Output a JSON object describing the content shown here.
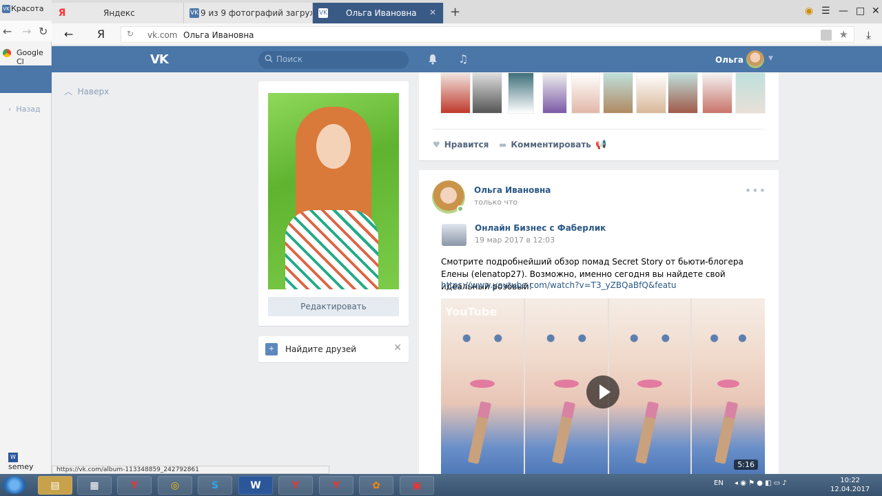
{
  "background_window": {
    "tab_title": "Красота",
    "bookmark": "Google Cl",
    "back_label": "Назад",
    "file_label": "semey"
  },
  "tabs": [
    {
      "title": "Яндекс",
      "icon": "yandex-icon"
    },
    {
      "title": "9 из 9 фотографий загруже",
      "icon": "vk-icon"
    },
    {
      "title": "Ольга Ивановна",
      "icon": "vk-icon",
      "active": true
    }
  ],
  "address": {
    "domain": "vk.com",
    "page_title": "Ольга Ивановна"
  },
  "vk": {
    "logo": "VK",
    "search_placeholder": "Поиск",
    "user_name": "Ольга",
    "nav_up": "Наверх"
  },
  "profile": {
    "edit_button": "Редактировать",
    "find_friends": "Найдите друзей"
  },
  "post_prev": {
    "like_label": "Нравится",
    "comment_label": "Комментировать"
  },
  "post": {
    "author": "Ольга Ивановна",
    "time": "только что",
    "repost_author": "Онлайн Бизнес с Фаберлик",
    "repost_time": "19 мар 2017 в 12:03",
    "text": "Смотрите подробнейший обзор помад Secret Story от бьюти-блогера Елены (elenatop27). Возможно, именно сегодня вы найдете свой идеальный розовый!",
    "link": "https://www.youtube.com/watch?v=T3_yZBQaBfQ&featu",
    "video_logo": "YouTube",
    "video_duration": "5:16"
  },
  "status_url": "https://vk.com/album-113348859_242792861",
  "taskbar": {
    "lang": "EN",
    "time": "10:22",
    "date": "12.04.2017"
  },
  "colors": {
    "vk_blue": "#4a76a8",
    "link": "#2a5885",
    "page_bg": "#edeef0"
  }
}
